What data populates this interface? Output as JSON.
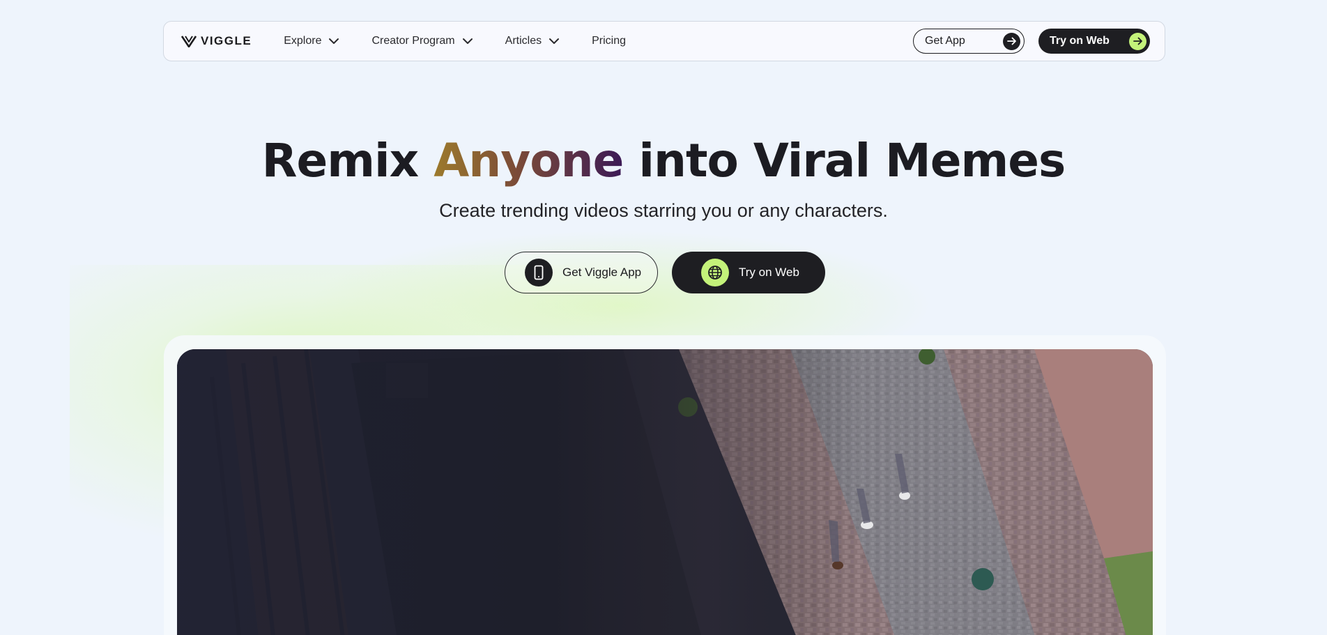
{
  "brand": {
    "name": "VIGGLE",
    "logo_icon": "viggle-v-logo"
  },
  "nav": {
    "items": [
      {
        "label": "Explore",
        "has_dropdown": true
      },
      {
        "label": "Creator Program",
        "has_dropdown": true
      },
      {
        "label": "Articles",
        "has_dropdown": true
      },
      {
        "label": "Pricing",
        "has_dropdown": false
      }
    ],
    "get_app_label": "Get App",
    "try_web_label": "Try on Web"
  },
  "hero": {
    "title_before": "Remix ",
    "title_accent": "Anyone",
    "title_after": " into Viral Memes",
    "subtitle": "Create trending videos starring you or any characters.",
    "cta_app_label": "Get Viggle App",
    "cta_web_label": "Try on Web"
  },
  "video": {
    "icon": "aerial-video-preview"
  },
  "colors": {
    "background": "#eef4fc",
    "dark": "#1e1e22",
    "lime": "#c4f27a",
    "accent_start": "#9c7a2c",
    "accent_end": "#3c1a56"
  }
}
